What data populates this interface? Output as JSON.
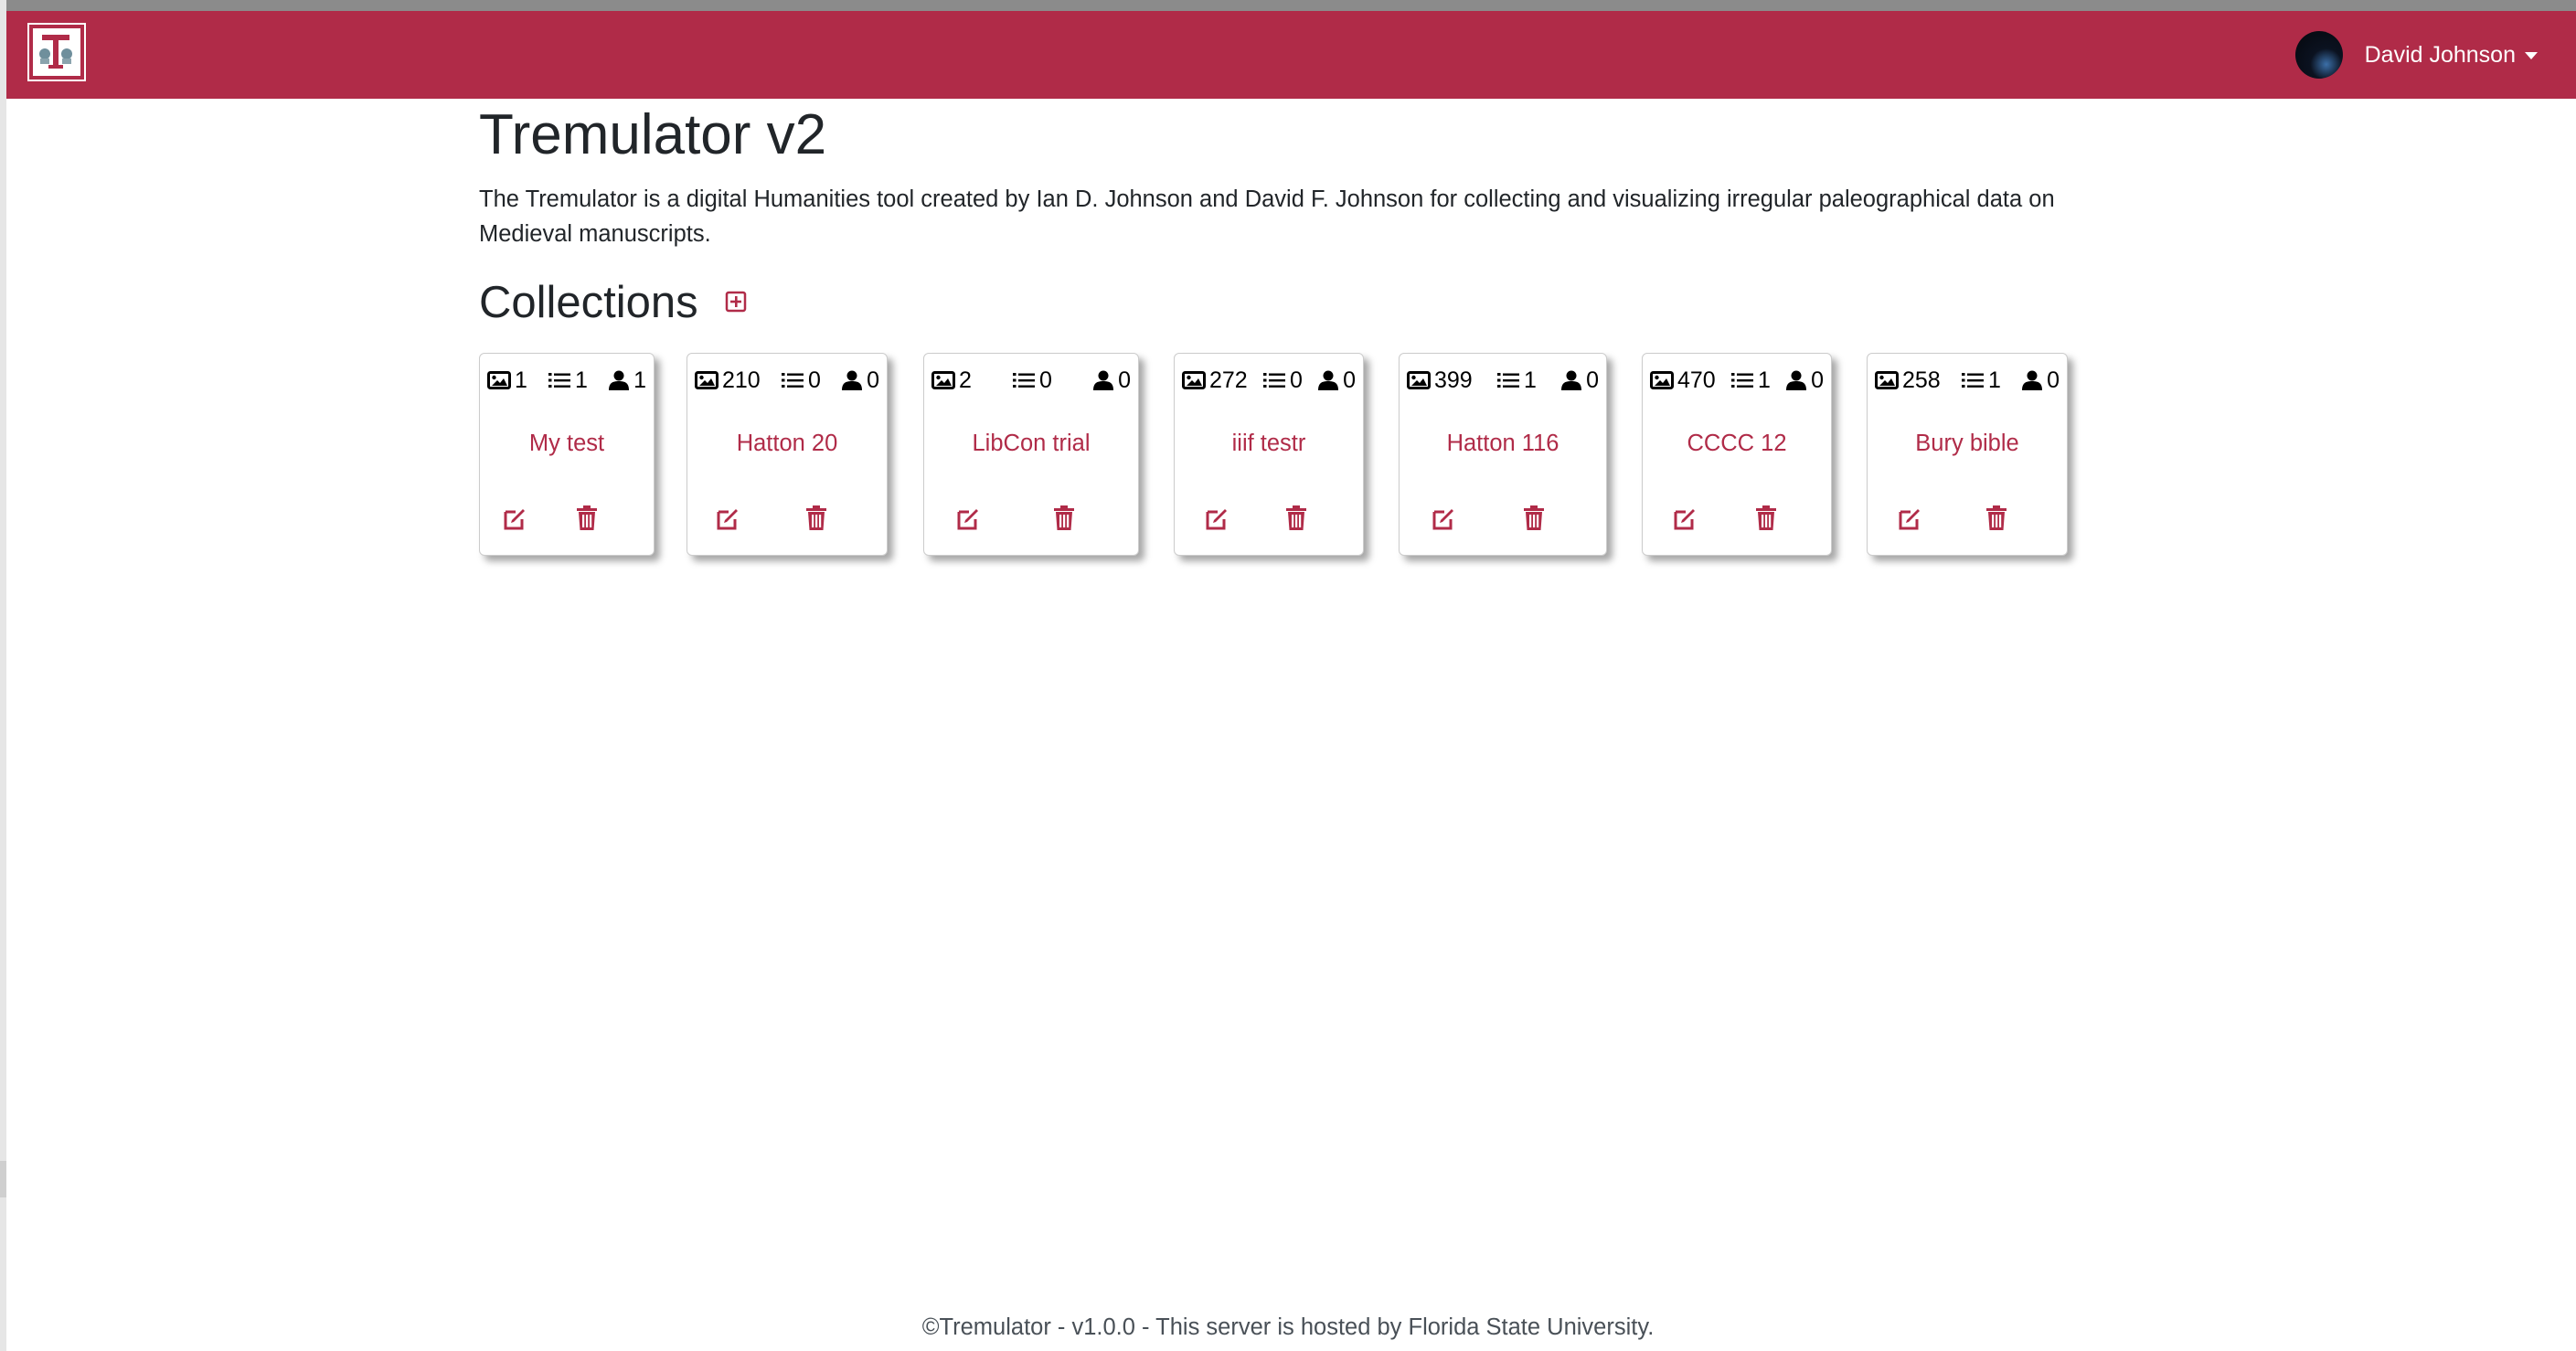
{
  "navbar": {
    "user_name": "David Johnson",
    "accent_color": "#b02b48"
  },
  "page": {
    "title": "Tremulator v2",
    "description": "The Tremulator is a digital Humanities tool created by Ian D. Johnson and David F. Johnson for collecting and visualizing irregular paleographical data on Medieval manuscripts."
  },
  "collections": {
    "heading": "Collections",
    "add_icon": "plus-square-icon",
    "items": [
      {
        "name": "My test",
        "images": "1",
        "lists": "1",
        "users": "1"
      },
      {
        "name": "Hatton 20",
        "images": "210",
        "lists": "0",
        "users": "0"
      },
      {
        "name": "LibCon trial",
        "images": "2",
        "lists": "0",
        "users": "0"
      },
      {
        "name": "iiif testr",
        "images": "272",
        "lists": "0",
        "users": "0"
      },
      {
        "name": "Hatton 116",
        "images": "399",
        "lists": "1",
        "users": "0"
      },
      {
        "name": "CCCC 12",
        "images": "470",
        "lists": "1",
        "users": "0"
      },
      {
        "name": "Bury bible",
        "images": "258",
        "lists": "1",
        "users": "0"
      }
    ]
  },
  "footer": {
    "text": "©Tremulator - v1.0.0 - This server is hosted by Florida State University."
  }
}
